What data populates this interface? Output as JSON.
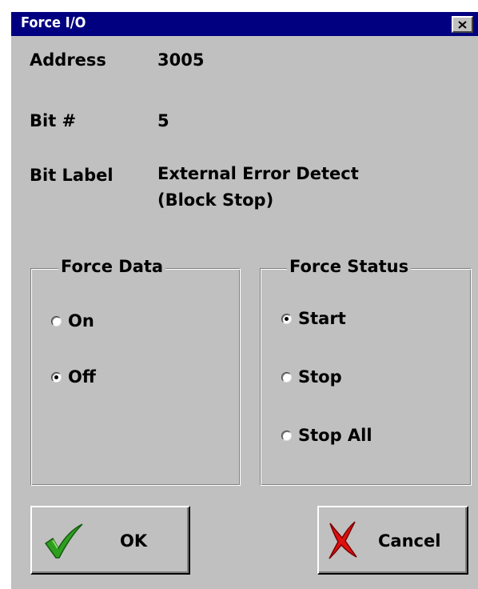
{
  "window": {
    "title": "Force I/O"
  },
  "fields": {
    "address_label": "Address",
    "address_value": "3005",
    "bit_label": "Bit #",
    "bit_value": "5",
    "bit_label_label": "Bit Label",
    "bit_label_value_line1": "External Error Detect",
    "bit_label_value_line2": "(Block Stop)"
  },
  "force_data": {
    "legend": "Force Data",
    "options": [
      {
        "label": "On",
        "checked": false
      },
      {
        "label": "Off",
        "checked": true
      }
    ]
  },
  "force_status": {
    "legend": "Force Status",
    "options": [
      {
        "label": "Start",
        "checked": true
      },
      {
        "label": "Stop",
        "checked": false
      },
      {
        "label": "Stop All",
        "checked": false
      }
    ]
  },
  "buttons": {
    "ok_label": "OK",
    "ok_icon": "checkmark-icon",
    "cancel_label": "Cancel",
    "cancel_icon": "x-icon"
  },
  "colors": {
    "titlebar": "#000080",
    "face": "#c0c0c0",
    "ok_icon": "#2e9e1f",
    "cancel_icon": "#e01010"
  }
}
